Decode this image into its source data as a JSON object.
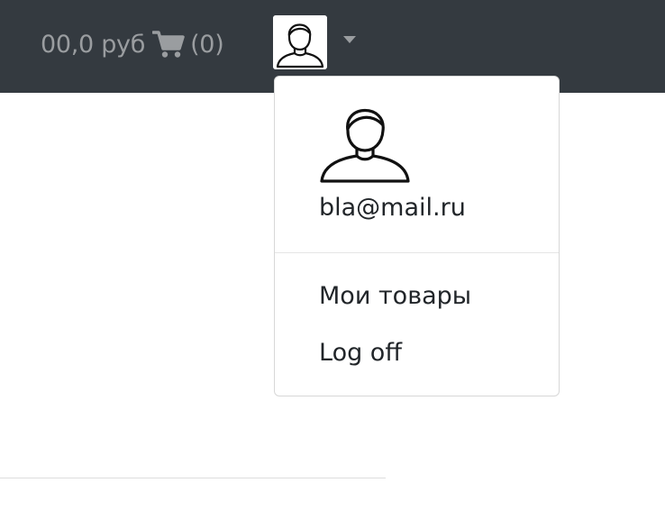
{
  "navbar": {
    "cart_total": "00,0 руб",
    "cart_count": "(0)",
    "cart_icon": "shopping-cart-icon",
    "user_icon": "user-avatar-icon",
    "background": "#343a40"
  },
  "dropdown": {
    "email": "bla@mail.ru",
    "items": [
      {
        "label": "Мои товары"
      },
      {
        "label": "Log off"
      }
    ]
  }
}
